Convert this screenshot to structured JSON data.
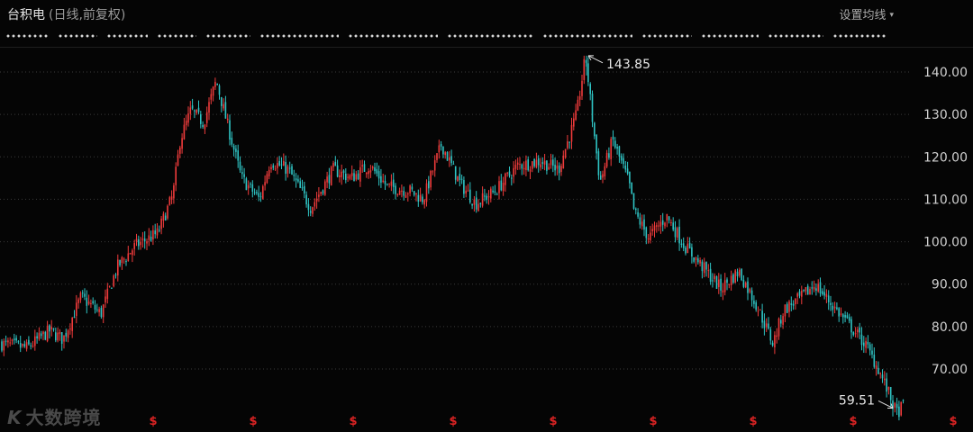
{
  "header": {
    "stock_name": "台积电",
    "chart_mode": "(日线,前复权)",
    "settings_label": "设置均线",
    "settings_caret": "▾"
  },
  "watermark": {
    "logo": "K",
    "text": "大数跨境"
  },
  "colors": {
    "up": "#ef3b3b",
    "down": "#2fc4c4",
    "grid": "#3a3a3a",
    "axis_text": "#d0d0d0",
    "marker": "#e02424"
  },
  "chart_data": {
    "type": "candlestick",
    "title": "台积电 (日线,前复权)",
    "ylim": [
      57,
      146
    ],
    "y_ticks": [
      "140.00",
      "130.00",
      "120.00",
      "110.00",
      "100.00",
      "90.00",
      "80.00",
      "70.00"
    ],
    "y_tick_values": [
      140,
      130,
      120,
      110,
      100,
      90,
      80,
      70
    ],
    "grid": "horizontal dotted",
    "annotations": [
      {
        "label": "143.85",
        "value": 143.85,
        "kind": "high"
      },
      {
        "label": "59.51",
        "value": 59.51,
        "kind": "low"
      }
    ],
    "event_marker_symbol": "$",
    "event_marker_count": 9,
    "trend_points": [
      [
        0,
        76
      ],
      [
        30,
        75
      ],
      [
        55,
        79
      ],
      [
        70,
        77
      ],
      [
        90,
        87
      ],
      [
        112,
        83
      ],
      [
        130,
        94
      ],
      [
        150,
        99
      ],
      [
        175,
        102
      ],
      [
        192,
        111
      ],
      [
        200,
        124
      ],
      [
        212,
        131
      ],
      [
        226,
        128
      ],
      [
        240,
        138
      ],
      [
        252,
        128
      ],
      [
        268,
        115
      ],
      [
        288,
        110
      ],
      [
        300,
        119
      ],
      [
        320,
        117
      ],
      [
        345,
        108
      ],
      [
        370,
        117
      ],
      [
        390,
        115
      ],
      [
        410,
        118
      ],
      [
        430,
        113
      ],
      [
        455,
        112
      ],
      [
        470,
        110
      ],
      [
        490,
        123
      ],
      [
        510,
        114
      ],
      [
        528,
        109
      ],
      [
        550,
        112
      ],
      [
        575,
        118
      ],
      [
        600,
        119
      ],
      [
        620,
        117
      ],
      [
        640,
        130
      ],
      [
        650,
        143.85
      ],
      [
        658,
        128
      ],
      [
        666,
        114
      ],
      [
        680,
        124
      ],
      [
        698,
        114
      ],
      [
        704,
        107
      ],
      [
        720,
        101
      ],
      [
        740,
        106
      ],
      [
        760,
        99
      ],
      [
        780,
        94
      ],
      [
        800,
        89
      ],
      [
        820,
        93
      ],
      [
        840,
        85
      ],
      [
        858,
        76
      ],
      [
        870,
        84
      ],
      [
        890,
        87
      ],
      [
        905,
        90
      ],
      [
        920,
        86
      ],
      [
        940,
        81
      ],
      [
        960,
        76
      ],
      [
        975,
        70
      ],
      [
        985,
        65
      ],
      [
        995,
        59.51
      ],
      [
        1005,
        62
      ]
    ]
  }
}
